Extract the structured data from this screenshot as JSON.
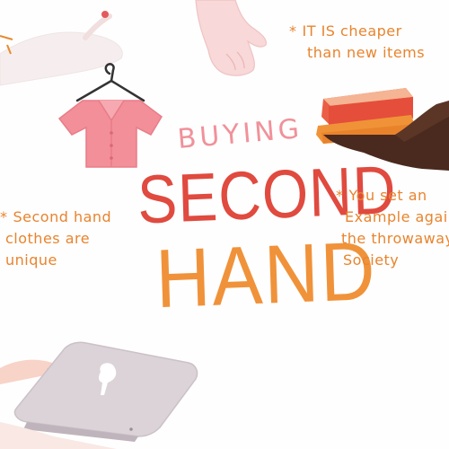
{
  "title": {
    "buying": "BUYING",
    "second": "SECOND",
    "hand": "HAND"
  },
  "notes": {
    "cheaper": {
      "bullet": "*",
      "line1": "IT IS cheaper",
      "line2": "than new items"
    },
    "example": {
      "bullet": "*",
      "line1": "You set an",
      "line2": "Example again",
      "line3": "the throwaway",
      "line4": "Society"
    },
    "unique": {
      "bullet": "*",
      "line1": "Second hand",
      "line2": "clothes are",
      "line3": "unique"
    }
  },
  "colors": {
    "orange": "#e8842e",
    "red": "#e04a3f",
    "pink": "#f1919a",
    "skin_light": "#f7d9d8",
    "skin_dark": "#5a3426",
    "laptop": "#d8cfd3"
  },
  "icons": {
    "shirt": "pink-shirt-on-hanger-icon",
    "hand_top": "reaching-hand-icon",
    "books": "books-held-by-hand-icon",
    "laptop": "laptop-held-by-hand-icon"
  }
}
